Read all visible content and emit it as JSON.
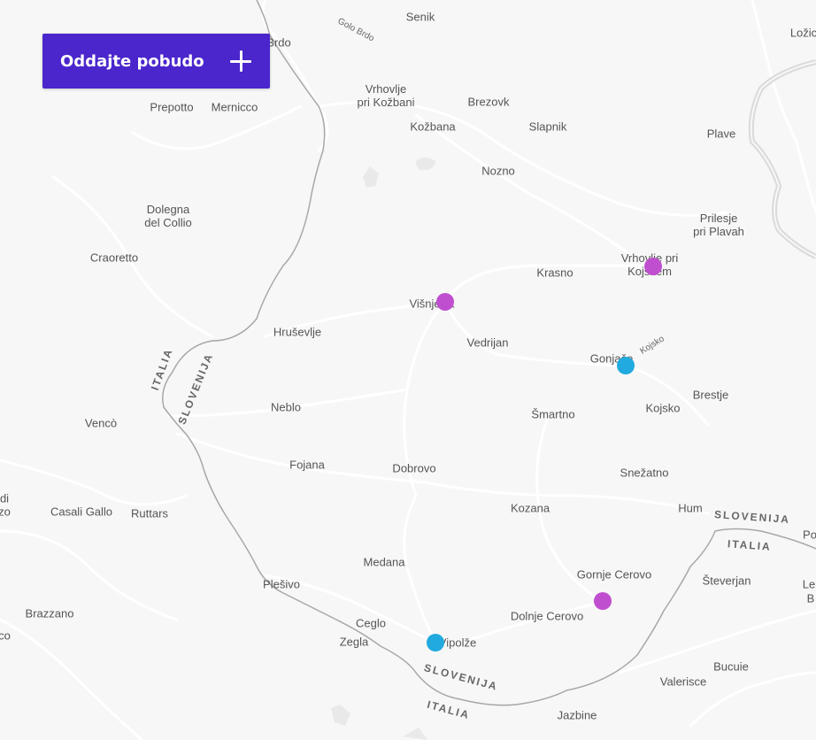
{
  "cta": {
    "label": "Oddajte pobudo",
    "icon": "plus-icon"
  },
  "colors": {
    "accent": "#4a26cc",
    "marker_magenta": "#c04fd0",
    "marker_cyan": "#21aadf",
    "background": "#f7f7f7",
    "road": "#ffffff",
    "border": "#a9a9a9"
  },
  "places": [
    {
      "id": "senik",
      "name": "Senik"
    },
    {
      "id": "golo-brdo",
      "name": "Golo Brdo"
    },
    {
      "id": "brdo",
      "name": "Brdo"
    },
    {
      "id": "lozice",
      "name": "Ložic"
    },
    {
      "id": "vrhovlje-kozbana",
      "name": "Vrhovlje\npri Kožbani"
    },
    {
      "id": "brezovk",
      "name": "Brezovk"
    },
    {
      "id": "prepotto",
      "name": "Prepotto"
    },
    {
      "id": "mernicco",
      "name": "Mernicco"
    },
    {
      "id": "kozbana",
      "name": "Kožbana"
    },
    {
      "id": "slapnik",
      "name": "Slapnik"
    },
    {
      "id": "plave",
      "name": "Plave"
    },
    {
      "id": "nozno",
      "name": "Nozno"
    },
    {
      "id": "dolegna",
      "name": "Dolegna\ndel Collio"
    },
    {
      "id": "prilesje",
      "name": "Prilesje\npri Plavah"
    },
    {
      "id": "craoretto",
      "name": "Craoretto"
    },
    {
      "id": "vrhovlje-kojsko",
      "name": "Vrhovlje pri\nKojskem"
    },
    {
      "id": "krasno",
      "name": "Krasno"
    },
    {
      "id": "visnjevik",
      "name": "Višnjevik"
    },
    {
      "id": "hrusevlje",
      "name": "Hruševlje"
    },
    {
      "id": "vedrijan",
      "name": "Vedrijan"
    },
    {
      "id": "gonjace",
      "name": "Gonjače"
    },
    {
      "id": "kojsko-road",
      "name": "Kojsko"
    },
    {
      "id": "brestje",
      "name": "Brestje"
    },
    {
      "id": "neblo",
      "name": "Neblo"
    },
    {
      "id": "smartno",
      "name": "Šmartno"
    },
    {
      "id": "kojsko",
      "name": "Kojsko"
    },
    {
      "id": "venco",
      "name": "Vencò"
    },
    {
      "id": "fojana",
      "name": "Fojana"
    },
    {
      "id": "dobrovo",
      "name": "Dobrovo"
    },
    {
      "id": "snezatno",
      "name": "Snežatno"
    },
    {
      "id": "di",
      "name": "di"
    },
    {
      "id": "zo",
      "name": "zo"
    },
    {
      "id": "casali-gallo",
      "name": "Casali Gallo"
    },
    {
      "id": "ruttars",
      "name": "Ruttars"
    },
    {
      "id": "kozana",
      "name": "Kozana"
    },
    {
      "id": "hum",
      "name": "Hum"
    },
    {
      "id": "po",
      "name": "Po"
    },
    {
      "id": "medana",
      "name": "Medana"
    },
    {
      "id": "gornje-cerovo",
      "name": "Gornje Cerovo"
    },
    {
      "id": "plesivo",
      "name": "Plešivo"
    },
    {
      "id": "steverjan",
      "name": "Števerjan"
    },
    {
      "id": "le",
      "name": "Le"
    },
    {
      "id": "b",
      "name": "B"
    },
    {
      "id": "brazzano",
      "name": "Brazzano"
    },
    {
      "id": "dolnje-cerovo",
      "name": "Dolnje Cerovo"
    },
    {
      "id": "ceglo",
      "name": "Ceglo"
    },
    {
      "id": "co",
      "name": "co"
    },
    {
      "id": "zegla",
      "name": "Zegla"
    },
    {
      "id": "vipolze",
      "name": "Vipolže"
    },
    {
      "id": "bucuie",
      "name": "Bucuie"
    },
    {
      "id": "valerisce",
      "name": "Valerisce"
    },
    {
      "id": "jazbine",
      "name": "Jazbine"
    }
  ],
  "border_labels": [
    {
      "id": "italia-west",
      "text": "ITALIA"
    },
    {
      "id": "slovenija-west",
      "text": "SLOVENIJA"
    },
    {
      "id": "slovenija-east",
      "text": "SLOVENIJA"
    },
    {
      "id": "italia-east",
      "text": "ITALIA"
    },
    {
      "id": "slovenija-south",
      "text": "SLOVENIJA"
    },
    {
      "id": "italia-south",
      "text": "ITALIA"
    }
  ],
  "markers": [
    {
      "id": "marker-vrhovlje",
      "color": "#c04fd0"
    },
    {
      "id": "marker-visnjevik",
      "color": "#c04fd0"
    },
    {
      "id": "marker-gonjace",
      "color": "#21aadf"
    },
    {
      "id": "marker-dolnje-cerovo",
      "color": "#c04fd0"
    },
    {
      "id": "marker-vipolze",
      "color": "#21aadf"
    }
  ]
}
